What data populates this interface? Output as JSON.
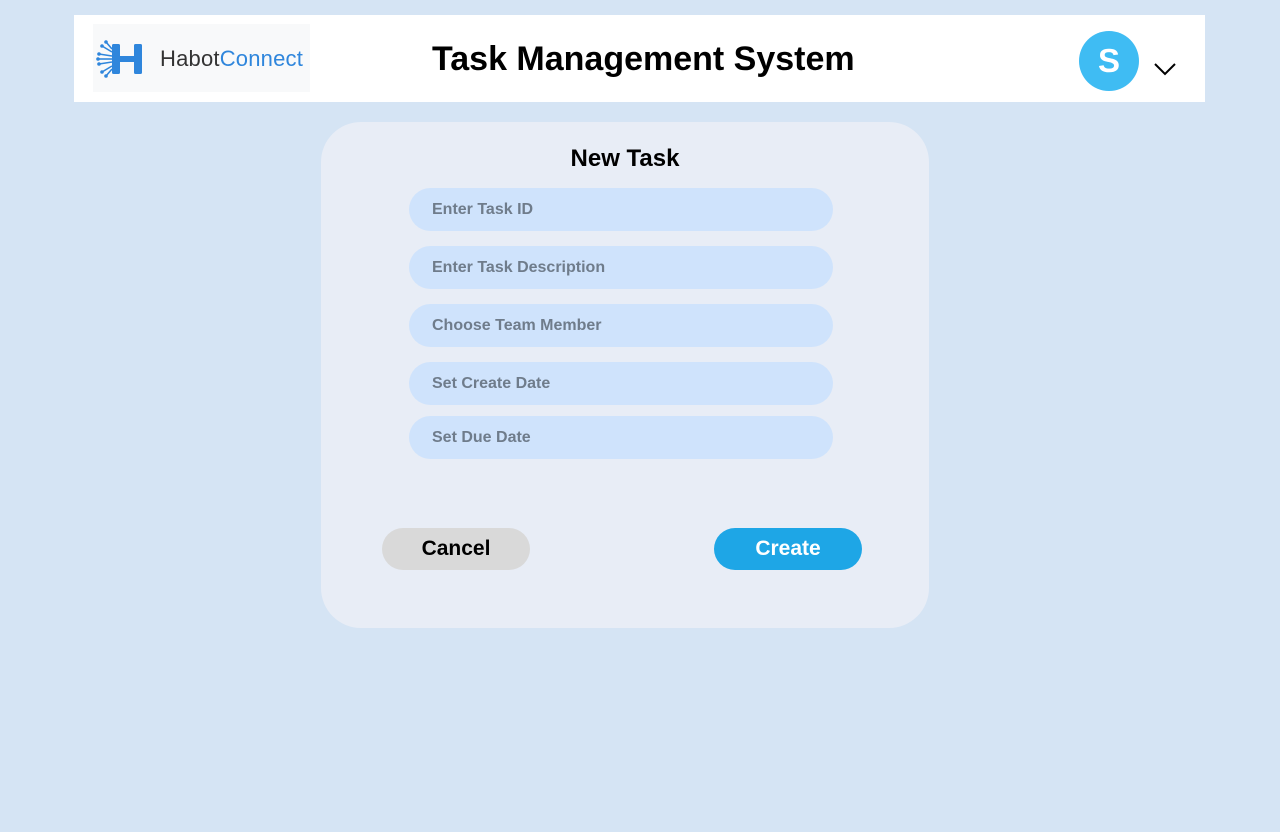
{
  "header": {
    "logo": {
      "brand_part1": "Habot",
      "brand_part2": "Connect"
    },
    "title": "Task Management System",
    "user": {
      "avatar_initial": "S",
      "menu_icon": "chevron-down-icon"
    }
  },
  "form": {
    "title": "New Task",
    "fields": [
      {
        "placeholder": "Enter Task ID",
        "value": ""
      },
      {
        "placeholder": "Enter Task Description",
        "value": ""
      },
      {
        "placeholder": "Choose Team Member",
        "value": ""
      },
      {
        "placeholder": "Set Create Date",
        "value": ""
      },
      {
        "placeholder": "Set Due Date",
        "value": ""
      }
    ],
    "cancel_label": "Cancel",
    "create_label": "Create"
  },
  "colors": {
    "page_background": "#d5e4f4",
    "card_background": "#e8edf6",
    "field_background": "#cfe3fc",
    "avatar": "#3fbcf3",
    "create_button": "#1ea6e6",
    "cancel_button": "#d9d9d9",
    "brand_blue": "#2f86dc"
  }
}
